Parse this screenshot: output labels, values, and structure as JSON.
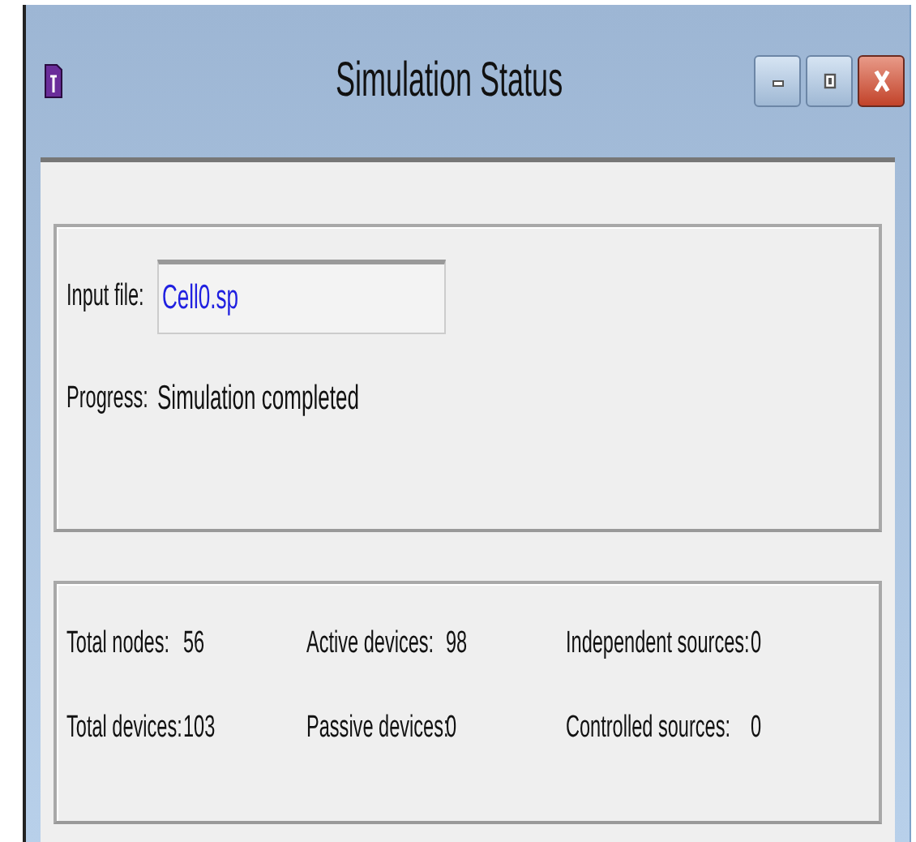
{
  "window": {
    "title": "Simulation Status"
  },
  "file_panel": {
    "input_file_label": "Input file:",
    "input_file_value": "Cell0.sp",
    "progress_label": "Progress:",
    "progress_value": "Simulation completed"
  },
  "stats": [
    {
      "label": "Total nodes:",
      "value": "56"
    },
    {
      "label": "Active devices:",
      "value": "98"
    },
    {
      "label": "Independent sources:",
      "value": "0"
    },
    {
      "label": "Total devices:",
      "value": "103"
    },
    {
      "label": "Passive devices:",
      "value": "0"
    },
    {
      "label": "Controlled sources:",
      "value": "0"
    }
  ]
}
